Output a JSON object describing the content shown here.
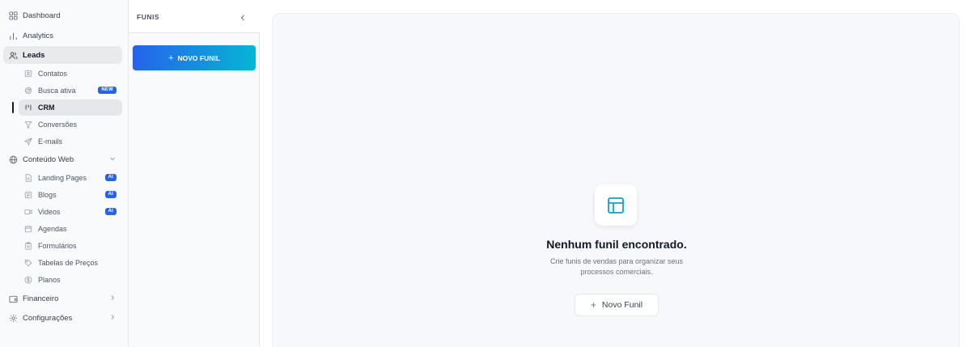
{
  "sidebar": {
    "items": [
      {
        "label": "Dashboard",
        "icon": "grid-icon"
      },
      {
        "label": "Analytics",
        "icon": "bar-chart-icon"
      },
      {
        "label": "Leads",
        "icon": "users-icon"
      },
      {
        "label": "Conteúdo Web",
        "icon": "globe-icon"
      },
      {
        "label": "Financeiro",
        "icon": "wallet-icon"
      },
      {
        "label": "Configurações",
        "icon": "gear-icon"
      }
    ],
    "leads_sub": [
      {
        "label": "Contatos",
        "icon": "contact-card-icon"
      },
      {
        "label": "Busca ativa",
        "icon": "radar-icon",
        "badge": "NEW"
      },
      {
        "label": "CRM",
        "icon": "kanban-icon"
      },
      {
        "label": "Conversões",
        "icon": "funnel-icon"
      },
      {
        "label": "E-mails",
        "icon": "send-icon"
      }
    ],
    "web_sub": [
      {
        "label": "Landing Pages",
        "icon": "file-icon",
        "badge": "AI"
      },
      {
        "label": "Blogs",
        "icon": "newspaper-icon",
        "badge": "AI"
      },
      {
        "label": "Videos",
        "icon": "video-icon",
        "badge": "AI"
      },
      {
        "label": "Agendas",
        "icon": "calendar-icon"
      },
      {
        "label": "Formulários",
        "icon": "clipboard-icon"
      },
      {
        "label": "Tabelas de Preços",
        "icon": "tag-icon"
      },
      {
        "label": "Planos",
        "icon": "dollar-circle-icon"
      }
    ]
  },
  "funnels": {
    "title": "FUNIS",
    "new_button": "NOVO FUNIL"
  },
  "empty_state": {
    "icon": "layout-icon",
    "title": "Nenhum funil encontrado.",
    "description": "Crie funis de vendas para organizar seus processos comerciais.",
    "button": "Novo Funil"
  },
  "colors": {
    "accent": "#2563eb",
    "gradient_end": "#06b6d4",
    "icon_teal": "#0ea5c6"
  }
}
